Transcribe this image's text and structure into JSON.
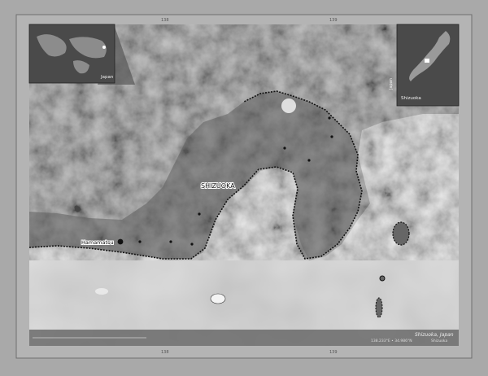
{
  "inset_world": {
    "label": "Japan"
  },
  "inset_japan": {
    "country_label": "Japan",
    "region_label": "Shizuoka"
  },
  "frame": {
    "top_ticks": [
      "138",
      "139"
    ],
    "bottom_ticks": [
      "138",
      "139"
    ]
  },
  "cities": {
    "capital": "SHIZUOKA",
    "major": "Hamamatsu"
  },
  "footer": {
    "title": "Shizuoka, Japan",
    "coords": "138.233°E • 34.986°N",
    "legend_text": "Shizuoka"
  },
  "colors": {
    "background": "#a9a9a9",
    "sea": "#dcdcdc",
    "land": "#6e6e6e",
    "region": "#5a5a5a",
    "border": "#111111"
  }
}
